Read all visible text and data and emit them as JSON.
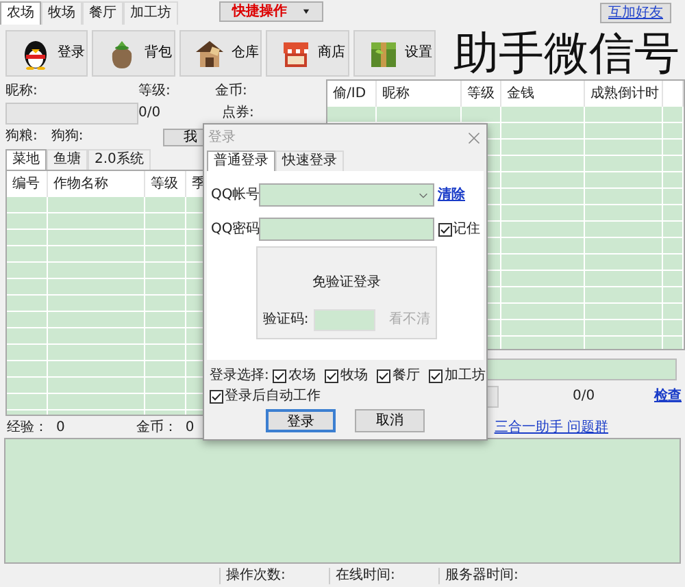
{
  "top_tabs": [
    {
      "label": "农场",
      "selected": true
    },
    {
      "label": "牧场",
      "selected": false
    },
    {
      "label": "餐厅",
      "selected": false
    },
    {
      "label": "加工坊",
      "selected": false
    }
  ],
  "quick_menu": "快捷操作",
  "add_friend_button": "互加好友",
  "toolbar": [
    {
      "label": "登录"
    },
    {
      "label": "背包"
    },
    {
      "label": "仓库"
    },
    {
      "label": "商店"
    },
    {
      "label": "设置"
    }
  ],
  "wechat_banner": "助手微信号",
  "profile": {
    "nickname_label": "昵称:",
    "level_label": "等级:",
    "level_value": "0/0",
    "gold_label": "金币:",
    "coupon_label": "点券:",
    "dog_food_label": "狗粮:",
    "dog_label": "狗狗:",
    "action_button": "我"
  },
  "land_tabs": [
    {
      "label": "菜地",
      "selected": true
    },
    {
      "label": "鱼塘",
      "selected": false
    },
    {
      "label": "2.0系统",
      "selected": false
    }
  ],
  "crop_table": {
    "columns": [
      "编号",
      "作物名称",
      "等级",
      "季"
    ]
  },
  "friend_table": {
    "columns": [
      "偷/ID",
      "昵称",
      "等级",
      "金钱",
      "成熟倒计时"
    ]
  },
  "progress": {
    "level": 0,
    "reading": "0/0",
    "check_link": "检查"
  },
  "stats": [
    {
      "label": "经验：",
      "value": "0"
    },
    {
      "label": "金币：",
      "value": "0"
    }
  ],
  "group_link": "三合一助手 问题群",
  "status_bar": [
    "操作次数:",
    "在线时间:",
    "服务器时间:"
  ],
  "dialog": {
    "title": "登录",
    "tabs": [
      {
        "label": "普通登录",
        "selected": true
      },
      {
        "label": "快速登录",
        "selected": false
      }
    ],
    "account_label": "QQ帐号",
    "clear_link": "清除",
    "password_label": "QQ密码",
    "remember": {
      "label": "记住",
      "checked": true
    },
    "no_verify_title": "免验证登录",
    "captcha_label": "验证码:",
    "captcha_refresh": "看不清",
    "login_choice_label": "登录选择:",
    "login_choices": [
      {
        "label": "农场",
        "checked": true
      },
      {
        "label": "牧场",
        "checked": true
      },
      {
        "label": "餐厅",
        "checked": true
      },
      {
        "label": "加工坊",
        "checked": true
      }
    ],
    "auto_work": {
      "label": "登录后自动工作",
      "checked": true
    },
    "buttons": [
      {
        "label": "登录",
        "focused": true
      },
      {
        "label": "取消",
        "focused": false
      }
    ]
  }
}
